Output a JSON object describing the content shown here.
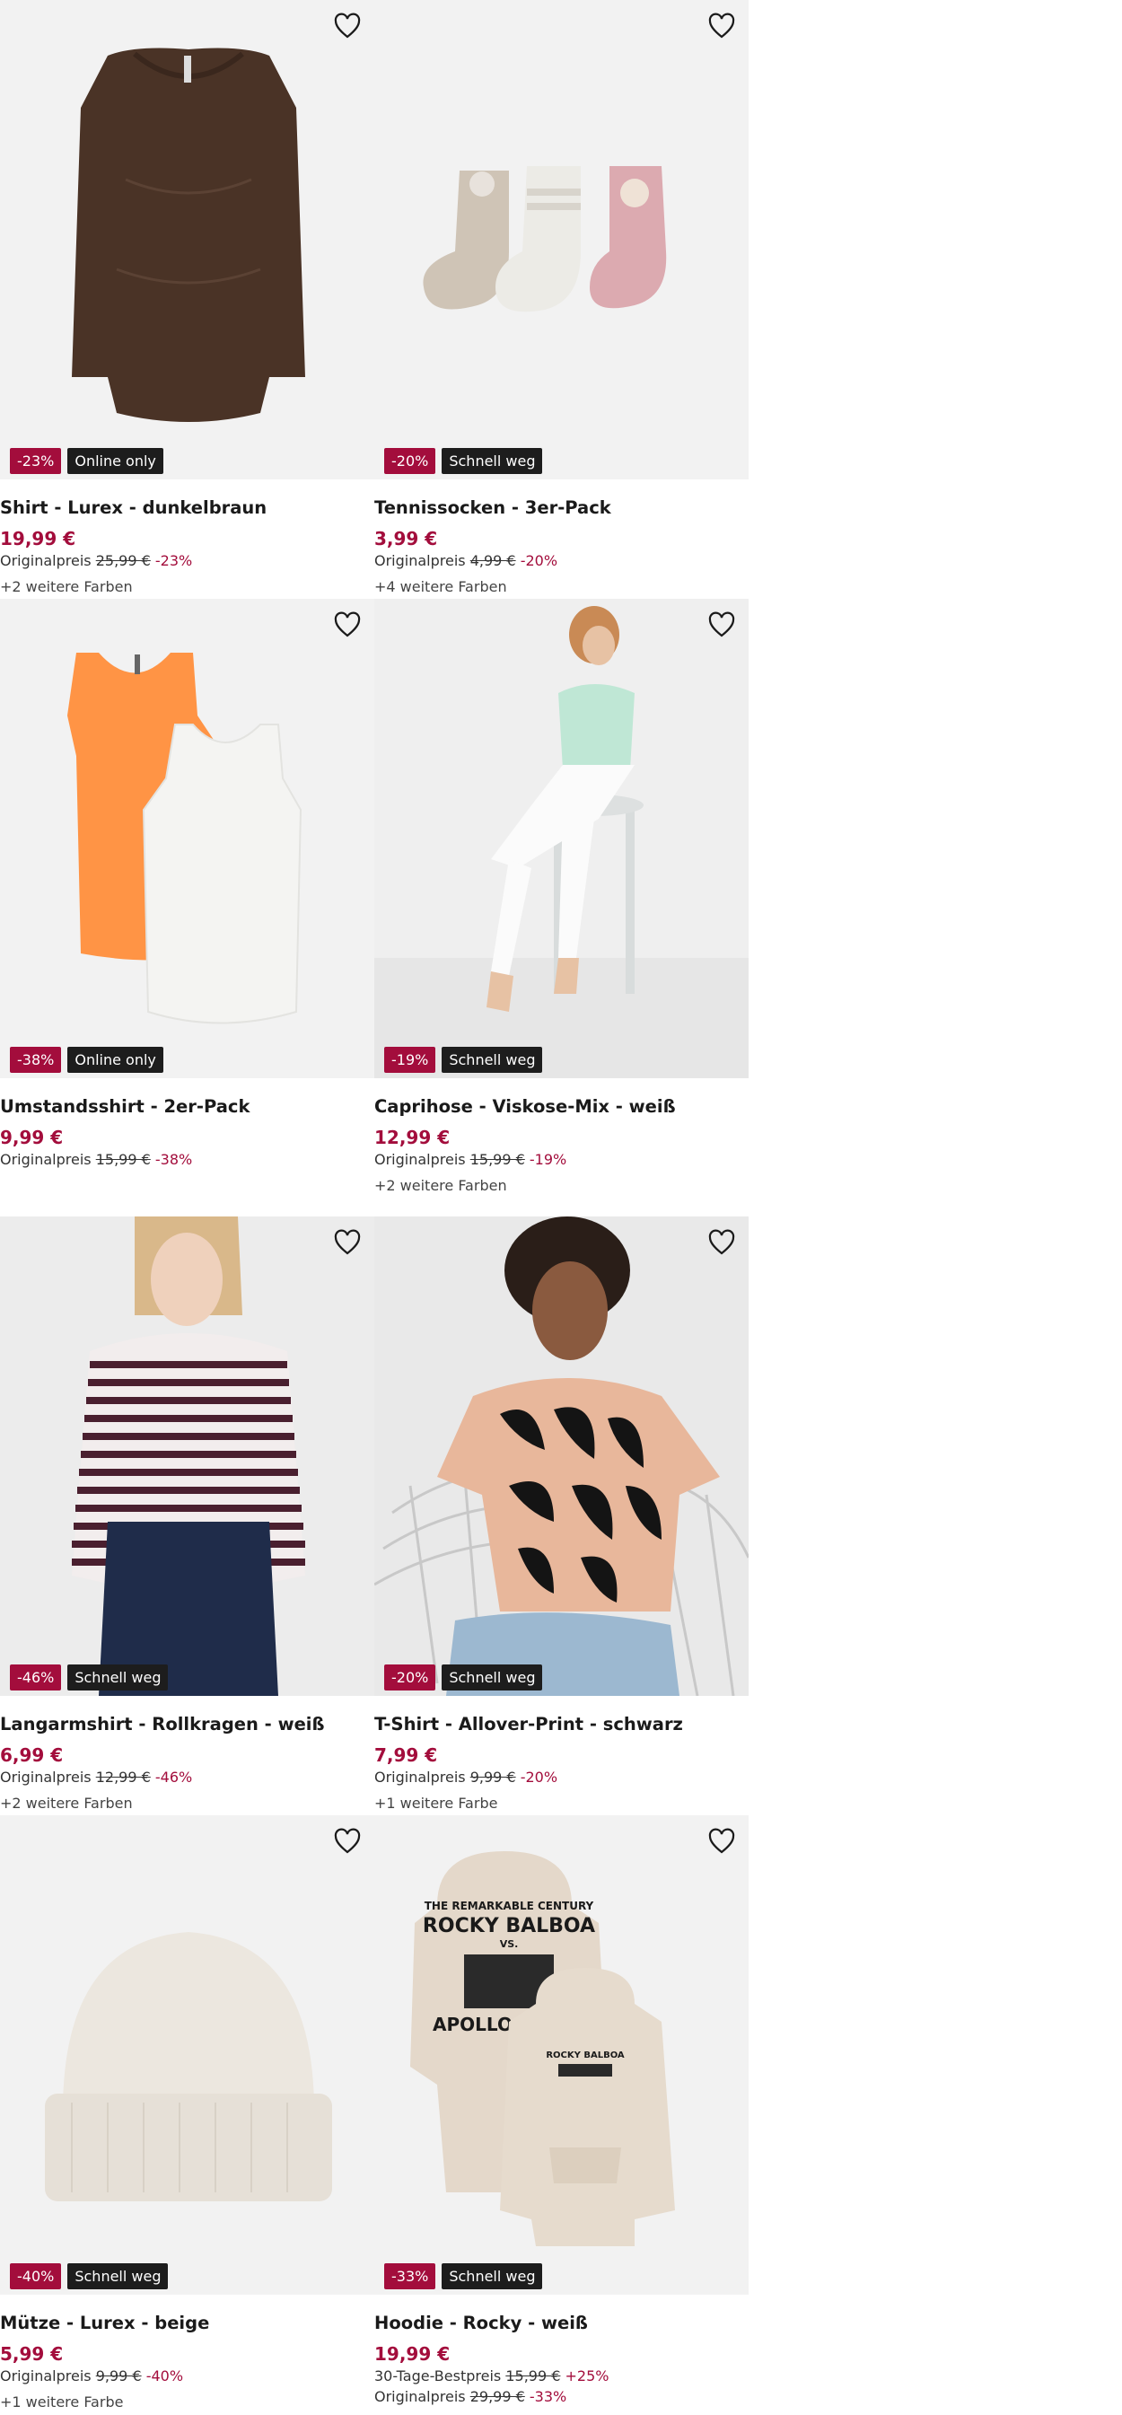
{
  "products": [
    {
      "title": "Shirt - Lurex - dunkelbraun",
      "price": "19,99 €",
      "badges": [
        "-23%",
        "Online only"
      ],
      "lines": [
        {
          "label": "Originalpreis",
          "old": "25,99 €",
          "pct": "-23%"
        }
      ],
      "more": "+2 weitere Farben",
      "image": "brown-shirt"
    },
    {
      "title": "Tennissocken - 3er-Pack",
      "price": "3,99 €",
      "badges": [
        "-20%",
        "Schnell weg"
      ],
      "lines": [
        {
          "label": "Originalpreis",
          "old": "4,99 €",
          "pct": "-20%"
        }
      ],
      "more": "+4 weitere Farben",
      "image": "socks"
    },
    {
      "title": "Umstandsshirt - 2er-Pack",
      "price": "9,99 €",
      "badges": [
        "-38%",
        "Online only"
      ],
      "lines": [
        {
          "label": "Originalpreis",
          "old": "15,99 €",
          "pct": "-38%"
        }
      ],
      "more": "",
      "image": "tank-tops"
    },
    {
      "title": "Caprihose - Viskose-Mix - weiß",
      "price": "12,99 €",
      "badges": [
        "-19%",
        "Schnell weg"
      ],
      "lines": [
        {
          "label": "Originalpreis",
          "old": "15,99 €",
          "pct": "-19%"
        }
      ],
      "more": "+2 weitere Farben",
      "image": "model-capri"
    },
    {
      "title": "Langarmshirt - Rollkragen - weiß",
      "price": "6,99 €",
      "badges": [
        "-46%",
        "Schnell weg"
      ],
      "lines": [
        {
          "label": "Originalpreis",
          "old": "12,99 €",
          "pct": "-46%"
        }
      ],
      "more": "+2 weitere Farben",
      "image": "model-stripes"
    },
    {
      "title": "T-Shirt - Allover-Print - schwarz",
      "price": "7,99 €",
      "badges": [
        "-20%",
        "Schnell weg"
      ],
      "lines": [
        {
          "label": "Originalpreis",
          "old": "9,99 €",
          "pct": "-20%"
        }
      ],
      "more": "+1 weitere Farbe",
      "image": "model-print"
    },
    {
      "title": "Mütze - Lurex - beige",
      "price": "5,99 €",
      "badges": [
        "-40%",
        "Schnell weg"
      ],
      "lines": [
        {
          "label": "Originalpreis",
          "old": "9,99 €",
          "pct": "-40%"
        }
      ],
      "more": "+1 weitere Farbe",
      "image": "beanie"
    },
    {
      "title": "Hoodie - Rocky - weiß",
      "price": "19,99 €",
      "badges": [
        "-33%",
        "Schnell weg"
      ],
      "lines": [
        {
          "label": "30-Tage-Bestpreis",
          "old": "15,99 €",
          "pct": "+25%"
        },
        {
          "label": "Originalpreis",
          "old": "29,99 €",
          "pct": "-33%"
        }
      ],
      "more": "",
      "image": "hoodies"
    }
  ],
  "hoodie_print": {
    "line1": "THE REMARKABLE CENTURY",
    "line2": "ROCKY BALBOA",
    "line3": "VS.",
    "line4": "APOLLO CREED",
    "small": "ROCKY BALBOA"
  },
  "icons": {
    "wishlist": "heart-outline-icon"
  },
  "colors": {
    "discount": "#a30d3c",
    "flag": "#1d1d1d",
    "image_bg": "#f2f2f2"
  }
}
